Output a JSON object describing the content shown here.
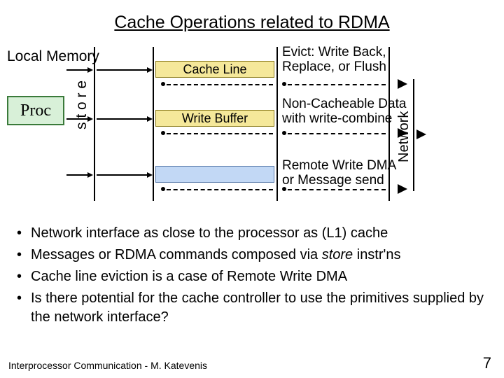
{
  "title": "Cache Operations related to RDMA",
  "diagram": {
    "local_memory_label": "Local Memory",
    "proc_label": "Proc",
    "store_label": "s t o r e",
    "network_label": "Network",
    "row1_box": "Cache Line",
    "row2_box": "Write Buffer",
    "row3_box": "",
    "right1a": "Evict: Write Back,",
    "right1b": "Replace, or Flush",
    "right2a": "Non-Cacheable Data",
    "right2b": "with write-combine",
    "right3a": "Remote Write DMA",
    "right3b": "or Message send"
  },
  "bullets": [
    {
      "text": "Network interface as close to the processor as (L1) cache"
    },
    {
      "prefix": "Messages or RDMA commands composed via ",
      "italic": "store",
      "suffix": " instr'ns"
    },
    {
      "text": "Cache line eviction is a case of Remote Write DMA"
    },
    {
      "text": "Is there potential for the cache controller to use the primitives supplied by the network interface?"
    }
  ],
  "footer_left": "Interprocessor Communication - M. Katevenis",
  "page_number": "7"
}
